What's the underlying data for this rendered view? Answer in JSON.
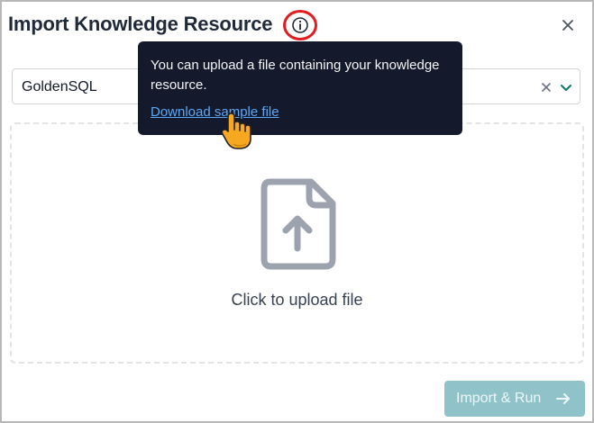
{
  "dialog": {
    "title": "Import Knowledge Resource"
  },
  "icons": {
    "info": "info-circle-icon",
    "close": "close-x-icon",
    "clear": "clear-x-icon",
    "chevron": "chevron-down-icon",
    "file_upload": "file-upload-icon",
    "arrow": "arrow-right-icon",
    "cursor": "pointing-hand-cursor"
  },
  "tooltip": {
    "text": "You can upload a file containing your knowledge resource.",
    "link_label": "Download sample file"
  },
  "resource_select": {
    "value": "GoldenSQL"
  },
  "dropzone": {
    "label": "Click to upload file"
  },
  "footer": {
    "import_button_label": "Import & Run"
  },
  "colors": {
    "highlight_ring": "#e11d1d",
    "tooltip_bg": "#141a2b",
    "link": "#5aa8f7",
    "primary_button_disabled": "#8fc3c9"
  }
}
